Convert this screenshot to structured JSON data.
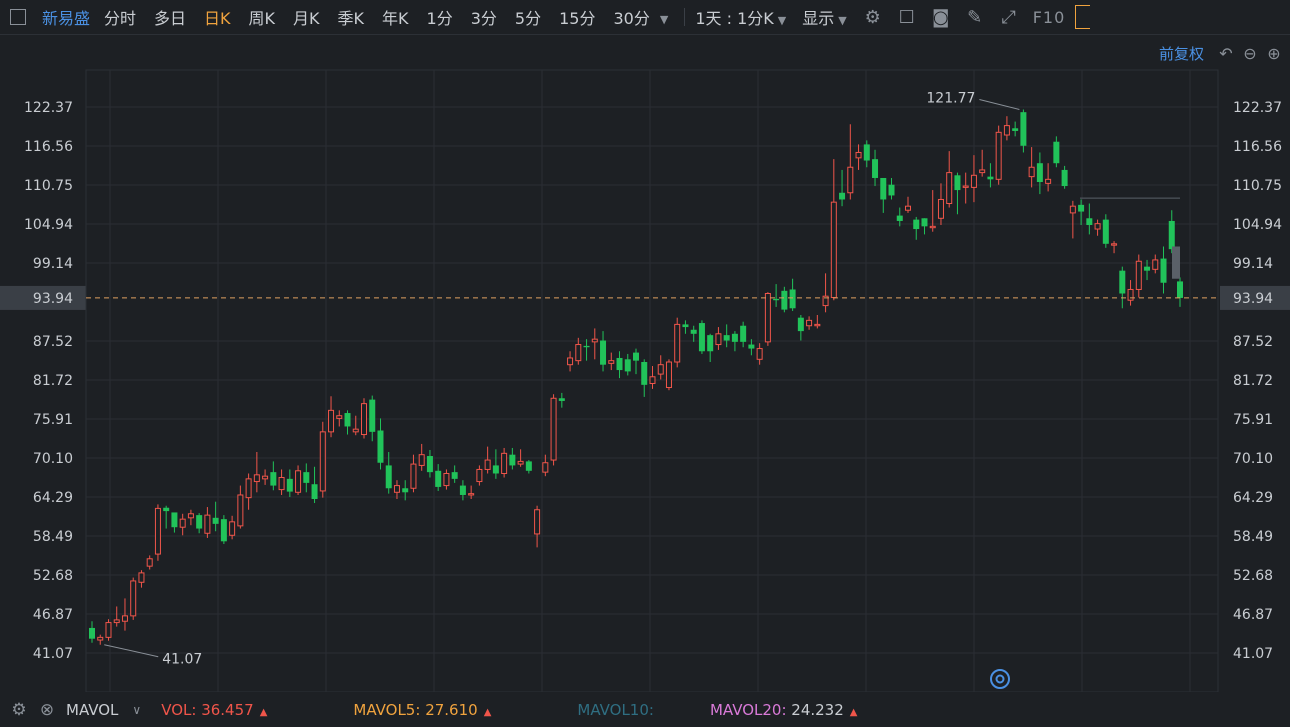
{
  "toolbar": {
    "stock_name": "新易盛",
    "periods": [
      "分时",
      "多日",
      "日K",
      "周K",
      "月K",
      "季K",
      "年K",
      "1分",
      "3分",
      "5分",
      "15分",
      "30分"
    ],
    "active_period": "日K",
    "range_dropdown": "1天 : 1分K",
    "display_label": "显示",
    "f10_label": "F10"
  },
  "subbar": {
    "adjust_label": "前复权"
  },
  "chart_data": {
    "type": "candlestick",
    "y_ticks": [
      122.37,
      116.56,
      110.75,
      104.94,
      99.14,
      93.94,
      87.52,
      81.72,
      75.91,
      70.1,
      64.29,
      58.49,
      52.68,
      46.87,
      41.07
    ],
    "ylim": [
      41.07,
      122.37
    ],
    "current_price": 93.94,
    "max_label": "121.77",
    "min_label": "41.07",
    "colors": {
      "up": "#f0554a",
      "down": "#21c35a",
      "price_line": "#e0a060",
      "price_tag_bg": "#3a3f46"
    },
    "candles": [
      [
        44.8,
        43.2,
        45.8,
        42.6
      ],
      [
        43.0,
        43.4,
        43.8,
        42.3
      ],
      [
        43.4,
        45.6,
        46.1,
        42.9
      ],
      [
        45.6,
        46.0,
        48.0,
        45.0
      ],
      [
        45.8,
        46.6,
        49.2,
        44.4
      ],
      [
        46.6,
        51.8,
        52.3,
        46.0
      ],
      [
        51.6,
        53.0,
        53.4,
        50.8
      ],
      [
        54.0,
        55.1,
        55.6,
        53.5
      ],
      [
        55.8,
        62.6,
        63.2,
        54.8
      ],
      [
        62.7,
        62.2,
        63.0,
        59.6
      ],
      [
        62.0,
        59.8,
        61.0,
        59.0
      ],
      [
        59.8,
        61.0,
        61.8,
        58.6
      ],
      [
        61.2,
        61.8,
        62.4,
        60.1
      ],
      [
        61.6,
        59.6,
        61.9,
        58.9
      ],
      [
        58.9,
        61.6,
        62.8,
        58.2
      ],
      [
        61.2,
        60.3,
        63.6,
        59.2
      ],
      [
        61.0,
        57.7,
        61.6,
        57.3
      ],
      [
        58.6,
        60.6,
        61.5,
        58.0
      ],
      [
        60.0,
        64.6,
        66.0,
        59.6
      ],
      [
        64.2,
        67.0,
        67.8,
        62.4
      ],
      [
        66.6,
        67.6,
        71.0,
        65.0
      ],
      [
        67.0,
        67.4,
        68.4,
        66.1
      ],
      [
        68.0,
        66.0,
        69.6,
        65.3
      ],
      [
        65.4,
        67.2,
        68.4,
        64.6
      ],
      [
        67.0,
        65.1,
        68.4,
        64.3
      ],
      [
        65.0,
        68.2,
        69.0,
        64.6
      ],
      [
        68.0,
        66.4,
        69.3,
        65.0
      ],
      [
        66.2,
        64.0,
        68.8,
        63.4
      ],
      [
        65.2,
        74.0,
        75.5,
        64.2
      ],
      [
        74.0,
        77.2,
        79.3,
        73.2
      ],
      [
        76.0,
        76.4,
        77.2,
        74.8
      ],
      [
        76.8,
        74.8,
        77.2,
        73.6
      ],
      [
        74.0,
        74.4,
        76.4,
        73.5
      ],
      [
        73.6,
        78.2,
        79.0,
        73.0
      ],
      [
        78.8,
        74.0,
        79.4,
        72.6
      ],
      [
        74.2,
        69.4,
        76.0,
        68.4
      ],
      [
        69.0,
        65.6,
        71.0,
        64.8
      ],
      [
        65.0,
        66.0,
        66.8,
        64.0
      ],
      [
        65.6,
        65.0,
        66.8,
        63.8
      ],
      [
        65.6,
        69.2,
        70.6,
        65.0
      ],
      [
        69.0,
        70.6,
        72.2,
        68.2
      ],
      [
        70.4,
        68.0,
        71.3,
        67.2
      ],
      [
        68.2,
        65.8,
        69.2,
        65.2
      ],
      [
        66.0,
        67.8,
        68.4,
        65.4
      ],
      [
        68.0,
        67.0,
        69.0,
        66.4
      ],
      [
        66.0,
        64.6,
        66.8,
        63.8
      ],
      [
        64.6,
        64.8,
        66.0,
        64.0
      ],
      [
        66.6,
        68.4,
        69.0,
        66.0
      ],
      [
        68.4,
        69.8,
        71.8,
        67.8
      ],
      [
        69.0,
        67.8,
        71.4,
        67.0
      ],
      [
        67.8,
        70.8,
        71.6,
        67.2
      ],
      [
        70.6,
        69.0,
        71.6,
        68.4
      ],
      [
        69.2,
        69.6,
        71.4,
        68.8
      ],
      [
        69.6,
        68.2,
        69.8,
        67.8
      ],
      [
        58.8,
        62.4,
        63.0,
        56.8
      ],
      [
        68.0,
        69.4,
        70.6,
        67.4
      ],
      [
        69.8,
        79.0,
        79.6,
        69.0
      ],
      [
        79.0,
        78.6,
        79.8,
        77.6
      ],
      [
        84.0,
        85.0,
        86.0,
        83.0
      ],
      [
        84.6,
        87.0,
        88.0,
        84.0
      ],
      [
        86.8,
        86.6,
        87.8,
        84.6
      ],
      [
        87.4,
        87.8,
        89.4,
        84.8
      ],
      [
        87.6,
        84.0,
        89.0,
        83.0
      ],
      [
        84.2,
        84.6,
        85.8,
        83.2
      ],
      [
        85.0,
        83.2,
        86.0,
        82.0
      ],
      [
        84.8,
        83.0,
        85.6,
        82.4
      ],
      [
        85.8,
        84.6,
        86.4,
        82.6
      ],
      [
        84.4,
        81.0,
        84.8,
        79.2
      ],
      [
        81.2,
        82.2,
        83.8,
        80.4
      ],
      [
        82.6,
        84.0,
        85.4,
        81.8
      ],
      [
        80.6,
        84.4,
        84.8,
        80.2
      ],
      [
        84.4,
        90.0,
        91.0,
        83.6
      ],
      [
        90.0,
        89.6,
        90.6,
        88.6
      ],
      [
        89.2,
        88.6,
        89.8,
        87.4
      ],
      [
        90.2,
        86.0,
        90.6,
        85.6
      ],
      [
        88.4,
        86.0,
        88.6,
        84.4
      ],
      [
        87.0,
        88.6,
        89.6,
        86.2
      ],
      [
        88.4,
        87.6,
        90.0,
        86.6
      ],
      [
        88.6,
        87.4,
        89.0,
        86.0
      ],
      [
        89.8,
        87.4,
        90.4,
        86.6
      ],
      [
        87.0,
        86.4,
        87.8,
        85.4
      ],
      [
        84.8,
        86.4,
        87.2,
        84.0
      ],
      [
        87.4,
        94.6,
        94.8,
        86.8
      ],
      [
        93.8,
        93.6,
        96.0,
        92.6
      ],
      [
        95.0,
        92.2,
        95.6,
        91.8
      ],
      [
        95.2,
        92.4,
        96.8,
        92.0
      ],
      [
        91.0,
        89.0,
        91.4,
        87.6
      ],
      [
        89.8,
        90.6,
        91.2,
        89.2
      ],
      [
        89.8,
        90.0,
        91.4,
        89.4
      ],
      [
        92.8,
        94.2,
        97.6,
        91.8
      ],
      [
        94.0,
        108.2,
        114.6,
        93.6
      ],
      [
        109.6,
        108.6,
        113.0,
        107.6
      ],
      [
        109.6,
        113.4,
        119.8,
        108.6
      ],
      [
        114.8,
        115.6,
        116.8,
        113.0
      ],
      [
        116.8,
        114.4,
        117.4,
        113.4
      ],
      [
        114.6,
        111.8,
        116.0,
        110.6
      ],
      [
        111.8,
        108.6,
        111.8,
        106.6
      ],
      [
        110.8,
        109.2,
        111.8,
        108.6
      ],
      [
        106.2,
        105.4,
        107.4,
        104.6
      ],
      [
        107.0,
        107.6,
        109.0,
        106.6
      ],
      [
        105.6,
        104.2,
        106.0,
        102.6
      ],
      [
        105.8,
        104.6,
        105.8,
        103.4
      ],
      [
        104.4,
        104.6,
        110.0,
        103.8
      ],
      [
        105.8,
        108.6,
        111.0,
        104.8
      ],
      [
        108.0,
        112.6,
        115.8,
        107.4
      ],
      [
        112.2,
        110.0,
        112.6,
        106.4
      ],
      [
        110.4,
        110.6,
        112.6,
        108.0
      ],
      [
        110.4,
        112.2,
        115.2,
        108.2
      ],
      [
        112.6,
        113.0,
        116.0,
        112.0
      ],
      [
        112.0,
        111.6,
        114.0,
        110.4
      ],
      [
        111.6,
        118.6,
        119.6,
        110.8
      ],
      [
        118.2,
        119.6,
        121.0,
        117.4
      ],
      [
        119.2,
        118.8,
        120.2,
        118.0
      ],
      [
        121.6,
        116.6,
        122.0,
        115.6
      ],
      [
        112.0,
        113.4,
        116.4,
        110.4
      ],
      [
        114.0,
        111.2,
        115.6,
        109.4
      ],
      [
        111.0,
        111.6,
        114.0,
        109.8
      ],
      [
        117.2,
        114.0,
        118.0,
        113.4
      ],
      [
        113.0,
        110.6,
        113.6,
        110.2
      ],
      [
        106.6,
        107.6,
        108.4,
        102.8
      ],
      [
        107.8,
        106.8,
        108.6,
        104.8
      ],
      [
        105.8,
        104.8,
        108.0,
        103.4
      ],
      [
        104.2,
        105.0,
        105.6,
        103.2
      ],
      [
        105.6,
        102.0,
        106.4,
        101.4
      ],
      [
        101.8,
        102.0,
        102.4,
        100.6
      ],
      [
        98.0,
        94.6,
        98.6,
        92.4
      ],
      [
        93.6,
        95.2,
        96.6,
        92.8
      ],
      [
        95.2,
        99.4,
        100.4,
        94.0
      ],
      [
        98.6,
        98.0,
        99.6,
        96.6
      ],
      [
        98.2,
        99.6,
        100.4,
        97.6
      ],
      [
        99.8,
        96.2,
        101.6,
        94.6
      ],
      [
        105.4,
        101.2,
        107.0,
        100.6
      ],
      [
        96.4,
        93.94,
        97.0,
        92.6
      ]
    ]
  },
  "bottombar": {
    "indicator_name": "MAVOL",
    "vol": {
      "label": "VOL:",
      "value": "36.457",
      "color": "#f0554a"
    },
    "mavol5": {
      "label": "MAVOL5:",
      "value": "27.610",
      "color": "#f0a33e"
    },
    "mavol10": {
      "label": "MAVOL10:",
      "value": "",
      "color": "#2f6e82"
    },
    "mavol20": {
      "label": "MAVOL20:",
      "value": "24.232",
      "color": "#d97ad8"
    }
  }
}
